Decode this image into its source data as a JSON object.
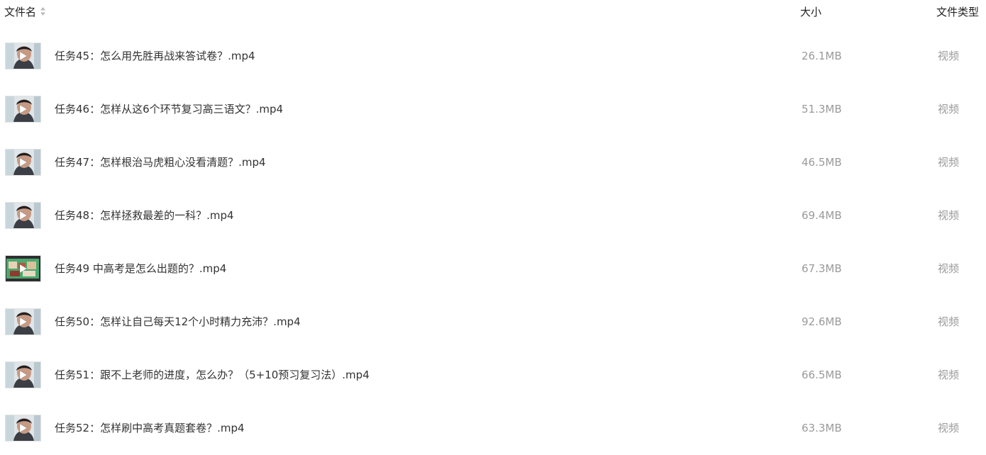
{
  "header": {
    "name_label": "文件名",
    "size_label": "大小",
    "type_label": "文件类型",
    "sort_icon": "sort-icon"
  },
  "files": [
    {
      "name": "任务45：怎么用先胜再战来答试卷？.mp4",
      "size": "26.1MB",
      "type": "视频",
      "thumb": "person"
    },
    {
      "name": "任务46：怎样从这6个环节复习高三语文？.mp4",
      "size": "51.3MB",
      "type": "视频",
      "thumb": "person"
    },
    {
      "name": "任务47：怎样根治马虎粗心没看清题？.mp4",
      "size": "46.5MB",
      "type": "视频",
      "thumb": "person"
    },
    {
      "name": "任务48：怎样拯救最差的一科？.mp4",
      "size": "69.4MB",
      "type": "视频",
      "thumb": "person"
    },
    {
      "name": "任务49 中高考是怎么出题的？.mp4",
      "size": "67.3MB",
      "type": "视频",
      "thumb": "slide"
    },
    {
      "name": "任务50：怎样让自己每天12个小时精力充沛？.mp4",
      "size": "92.6MB",
      "type": "视频",
      "thumb": "person"
    },
    {
      "name": "任务51：跟不上老师的进度，怎么办？（5+10预习复习法）.mp4",
      "size": "66.5MB",
      "type": "视频",
      "thumb": "person"
    },
    {
      "name": "任务52：怎样刷中高考真题套卷？.mp4",
      "size": "63.3MB",
      "type": "视频",
      "thumb": "person"
    }
  ]
}
